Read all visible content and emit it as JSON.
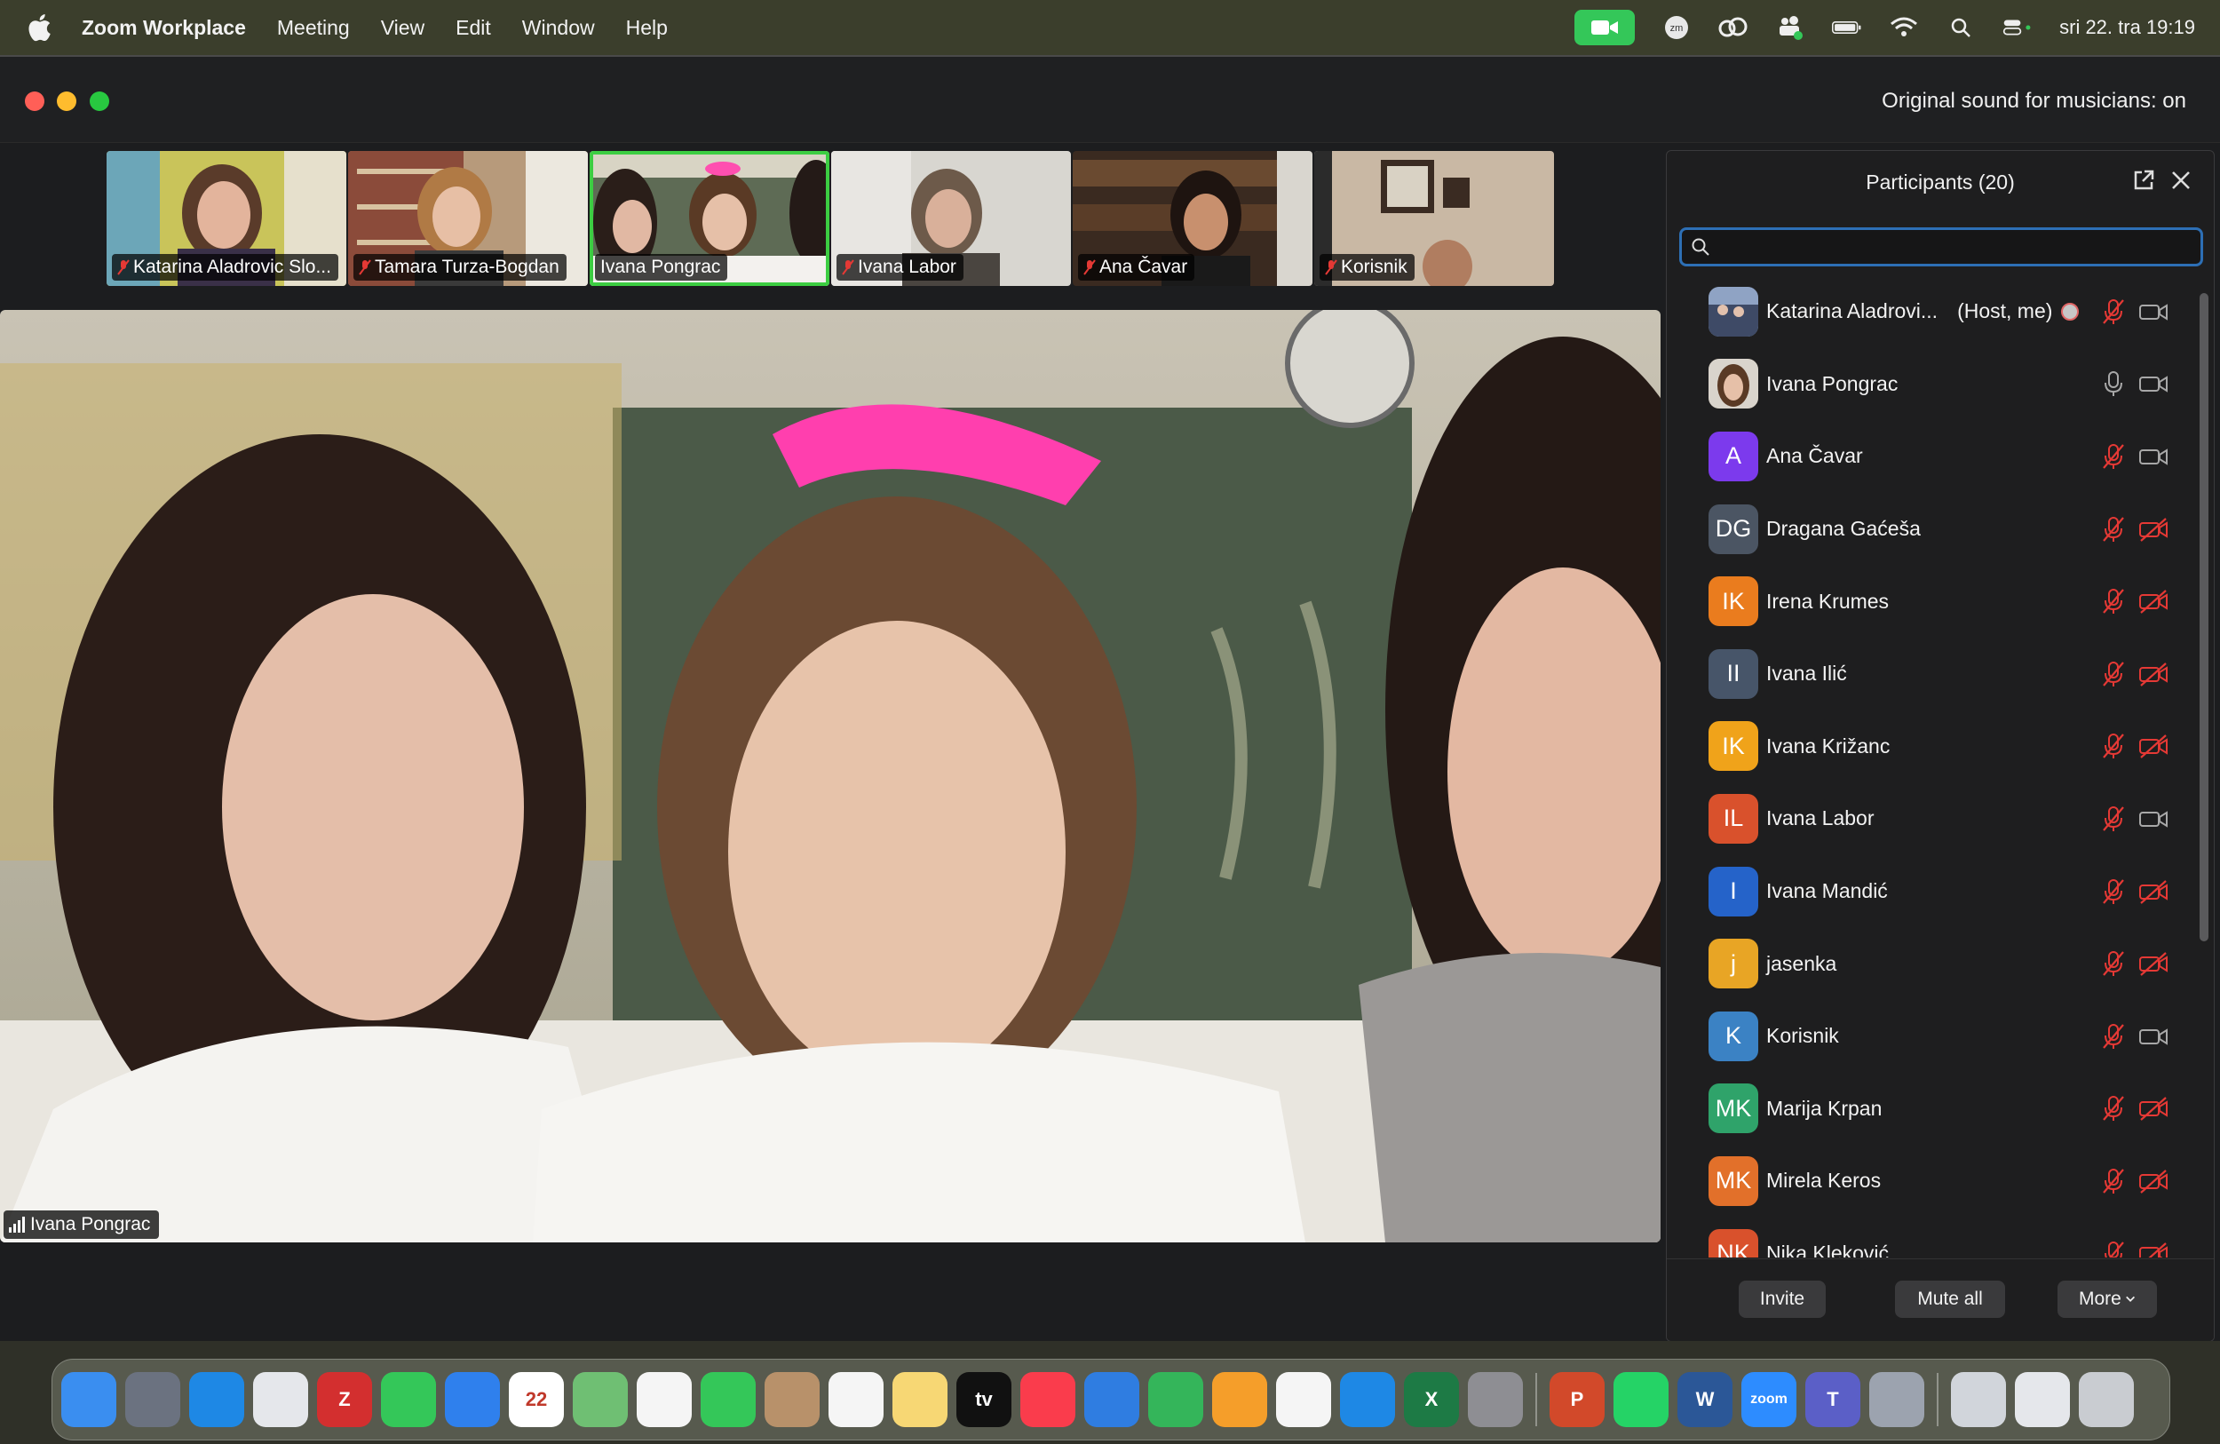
{
  "menubar": {
    "app_name": "Zoom Workplace",
    "items": [
      "Meeting",
      "View",
      "Edit",
      "Window",
      "Help"
    ],
    "clock": "sri 22. tra  19:19"
  },
  "window": {
    "original_sound": "Original sound for musicians: on"
  },
  "thumbnails": [
    {
      "name": "Katarina Aladrovic Slo...",
      "muted": true,
      "active": false
    },
    {
      "name": "Tamara Turza-Bogdan",
      "muted": true,
      "active": false
    },
    {
      "name": "Ivana Pongrac",
      "muted": false,
      "active": true
    },
    {
      "name": "Ivana Labor",
      "muted": true,
      "active": false
    },
    {
      "name": "Ana Čavar",
      "muted": true,
      "active": false
    },
    {
      "name": "Korisnik",
      "muted": true,
      "active": false
    }
  ],
  "main_video": {
    "speaker_name": "Ivana Pongrac"
  },
  "participants_panel": {
    "title": "Participants (20)",
    "search_placeholder": "",
    "participants": [
      {
        "initials": "",
        "name": "Katarina Aladrovi...",
        "role": "(Host, me)",
        "color": "#5b6b8c",
        "photo": true,
        "mic": "muted",
        "cam": "on",
        "recording": true
      },
      {
        "initials": "",
        "name": "Ivana Pongrac",
        "role": "",
        "color": "#8b7355",
        "photo": true,
        "mic": "on",
        "cam": "on",
        "recording": false
      },
      {
        "initials": "A",
        "name": "Ana Čavar",
        "role": "",
        "color": "#7c3aed",
        "photo": false,
        "mic": "muted",
        "cam": "on",
        "recording": false
      },
      {
        "initials": "DG",
        "name": "Dragana Gaćeša",
        "role": "",
        "color": "#4b5563",
        "photo": false,
        "mic": "muted",
        "cam": "off",
        "recording": false
      },
      {
        "initials": "IK",
        "name": "Irena Krumes",
        "role": "",
        "color": "#ea7c1e",
        "photo": false,
        "mic": "muted",
        "cam": "off",
        "recording": false
      },
      {
        "initials": "II",
        "name": "Ivana Ilić",
        "role": "",
        "color": "#475569",
        "photo": false,
        "mic": "muted",
        "cam": "off",
        "recording": false
      },
      {
        "initials": "IK",
        "name": "Ivana Križanc",
        "role": "",
        "color": "#f0a31a",
        "photo": false,
        "mic": "muted",
        "cam": "off",
        "recording": false
      },
      {
        "initials": "IL",
        "name": "Ivana Labor",
        "role": "",
        "color": "#d9512c",
        "photo": false,
        "mic": "muted",
        "cam": "on",
        "recording": false
      },
      {
        "initials": "I",
        "name": "Ivana Mandić",
        "role": "",
        "color": "#2563c9",
        "photo": false,
        "mic": "muted",
        "cam": "off",
        "recording": false
      },
      {
        "initials": "j",
        "name": "jasenka",
        "role": "",
        "color": "#e8a525",
        "photo": false,
        "mic": "muted",
        "cam": "off",
        "recording": false
      },
      {
        "initials": "K",
        "name": "Korisnik",
        "role": "",
        "color": "#3b82c4",
        "photo": false,
        "mic": "muted",
        "cam": "on",
        "recording": false
      },
      {
        "initials": "MK",
        "name": "Marija Krpan",
        "role": "",
        "color": "#2fa36a",
        "photo": false,
        "mic": "muted",
        "cam": "off",
        "recording": false
      },
      {
        "initials": "MK",
        "name": "Mirela Keros",
        "role": "",
        "color": "#e2702a",
        "photo": false,
        "mic": "muted",
        "cam": "off",
        "recording": false
      },
      {
        "initials": "NK",
        "name": "Nika Kleković",
        "role": "",
        "color": "#d9512c",
        "photo": false,
        "mic": "muted",
        "cam": "off",
        "recording": false
      }
    ],
    "buttons": {
      "invite": "Invite",
      "mute_all": "Mute all",
      "more": "More"
    }
  },
  "dock": {
    "icons": [
      {
        "name": "finder-icon",
        "label": "",
        "color": "#3a8ef0"
      },
      {
        "name": "launchpad-icon",
        "label": "",
        "color": "#6b7280"
      },
      {
        "name": "safari-icon",
        "label": "",
        "color": "#1e88e5"
      },
      {
        "name": "chrome-icon",
        "label": "",
        "color": "#e5e7eb"
      },
      {
        "name": "zotero-icon",
        "label": "Z",
        "color": "#d32f2f"
      },
      {
        "name": "messages-icon",
        "label": "",
        "color": "#34c759"
      },
      {
        "name": "mail-icon",
        "label": "",
        "color": "#2f80ed"
      },
      {
        "name": "calendar-icon",
        "label": "22",
        "color": "#ffffff"
      },
      {
        "name": "maps-icon",
        "label": "",
        "color": "#6fbf73"
      },
      {
        "name": "photos-icon",
        "label": "",
        "color": "#f5f5f5"
      },
      {
        "name": "facetime-icon",
        "label": "",
        "color": "#34c759"
      },
      {
        "name": "contacts-icon",
        "label": "",
        "color": "#b8916a"
      },
      {
        "name": "reminders-icon",
        "label": "",
        "color": "#f5f5f5"
      },
      {
        "name": "notes-icon",
        "label": "",
        "color": "#f7d774"
      },
      {
        "name": "appletv-icon",
        "label": "tv",
        "color": "#111111"
      },
      {
        "name": "music-icon",
        "label": "",
        "color": "#fa3c4c"
      },
      {
        "name": "keynote-icon",
        "label": "",
        "color": "#2f7de1"
      },
      {
        "name": "numbers-icon",
        "label": "",
        "color": "#34b55a"
      },
      {
        "name": "pages-icon",
        "label": "",
        "color": "#f59e2a"
      },
      {
        "name": "freeform-icon",
        "label": "",
        "color": "#f5f5f5"
      },
      {
        "name": "appstore-icon",
        "label": "",
        "color": "#1e88e5"
      },
      {
        "name": "excel-icon",
        "label": "X",
        "color": "#1d7a45"
      },
      {
        "name": "settings-icon",
        "label": "",
        "color": "#8e8e93"
      },
      {
        "name": "powerpoint-icon",
        "label": "P",
        "color": "#d2492a"
      },
      {
        "name": "whatsapp-icon",
        "label": "",
        "color": "#25d366"
      },
      {
        "name": "word-icon",
        "label": "W",
        "color": "#2b5797"
      },
      {
        "name": "zoom-icon",
        "label": "zoom",
        "color": "#2d8cff"
      },
      {
        "name": "teams-icon",
        "label": "T",
        "color": "#5b5fc7"
      },
      {
        "name": "preview-icon",
        "label": "",
        "color": "#9ca3af"
      },
      {
        "name": "downloads-icon",
        "label": "",
        "color": "#d1d5db"
      },
      {
        "name": "documents-icon",
        "label": "",
        "color": "#e5e7eb"
      },
      {
        "name": "trash-icon",
        "label": "",
        "color": "#c9ccd1"
      }
    ]
  }
}
